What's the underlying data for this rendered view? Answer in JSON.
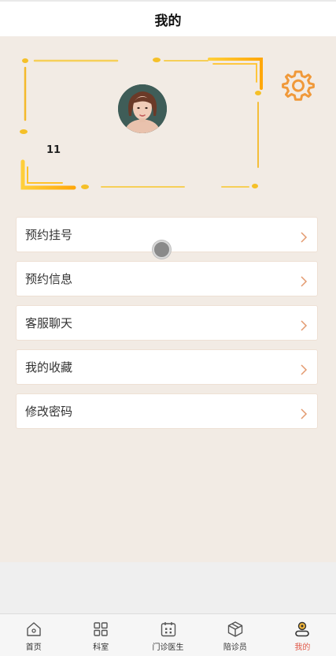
{
  "header": {
    "title": "我的"
  },
  "profile": {
    "user_id": "11",
    "avatar": "avatar-photo"
  },
  "settings": {
    "icon": "gear-icon",
    "color": "#f0993a"
  },
  "menu": {
    "items": [
      {
        "label": "预约挂号"
      },
      {
        "label": "预约信息"
      },
      {
        "label": "客服聊天"
      },
      {
        "label": "我的收藏"
      },
      {
        "label": "修改密码"
      }
    ]
  },
  "tabbar": {
    "active_color": "#e05a4a",
    "items": [
      {
        "label": "首页",
        "icon": "home-icon"
      },
      {
        "label": "科室",
        "icon": "grid-icon"
      },
      {
        "label": "门诊医生",
        "icon": "calendar-icon"
      },
      {
        "label": "陪诊员",
        "icon": "box-icon"
      },
      {
        "label": "我的",
        "icon": "user-icon"
      }
    ]
  }
}
